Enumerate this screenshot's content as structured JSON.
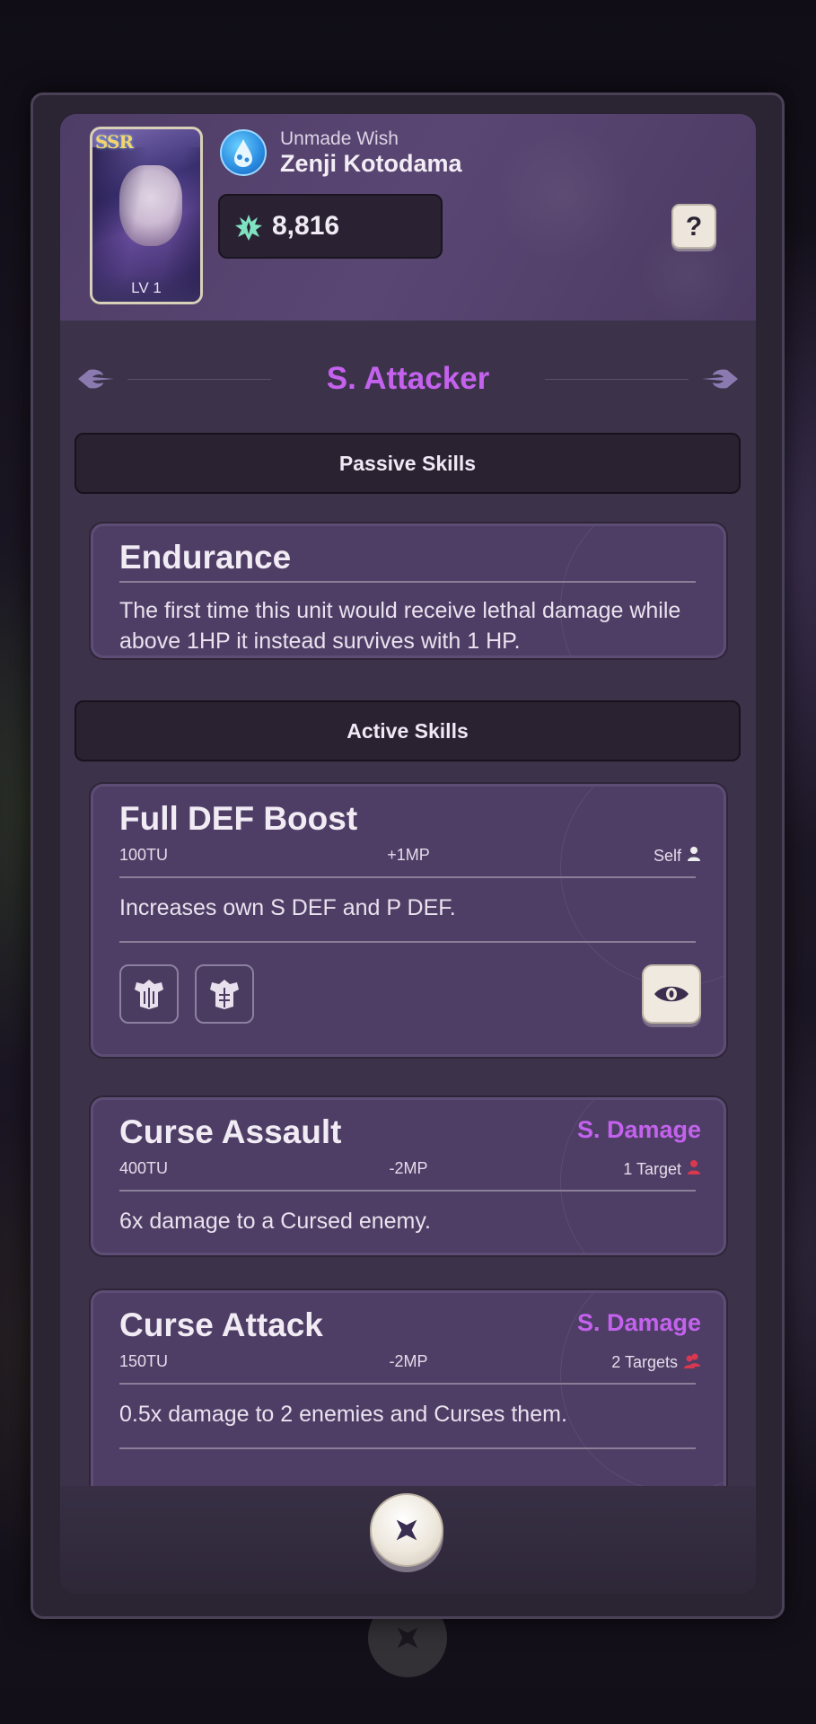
{
  "unit": {
    "rarity": "SSR",
    "level": "LV 1",
    "subtitle": "Unmade Wish",
    "name": "Zenji Kotodama",
    "power": "8,816"
  },
  "help_label": "?",
  "class_title": "S. Attacker",
  "sections": {
    "passive": "Passive Skills",
    "active": "Active Skills"
  },
  "passive_skills": [
    {
      "name": "Endurance",
      "description": "The first time this unit would receive lethal damage while above 1HP it instead survives with 1 HP."
    }
  ],
  "active_skills": [
    {
      "name": "Full DEF Boost",
      "type": "",
      "tu": "100TU",
      "mp": "+1MP",
      "target": "Self",
      "target_icon": "person-icon",
      "description": "Increases own S DEF and P DEF."
    },
    {
      "name": "Curse Assault",
      "type": "S. Damage",
      "tu": "400TU",
      "mp": "-2MP",
      "target": "1 Target",
      "target_icon": "enemy-icon",
      "description": "6x damage to a Cursed enemy."
    },
    {
      "name": "Curse Attack",
      "type": "S. Damage",
      "tu": "150TU",
      "mp": "-2MP",
      "target": "2 Targets",
      "target_icon": "enemies-icon",
      "description": "0.5x damage to 2 enemies and Curses them."
    }
  ],
  "colors": {
    "accent_purple": "#c462ee",
    "enemy_red": "#d9384f",
    "panel": "#3c3249"
  }
}
